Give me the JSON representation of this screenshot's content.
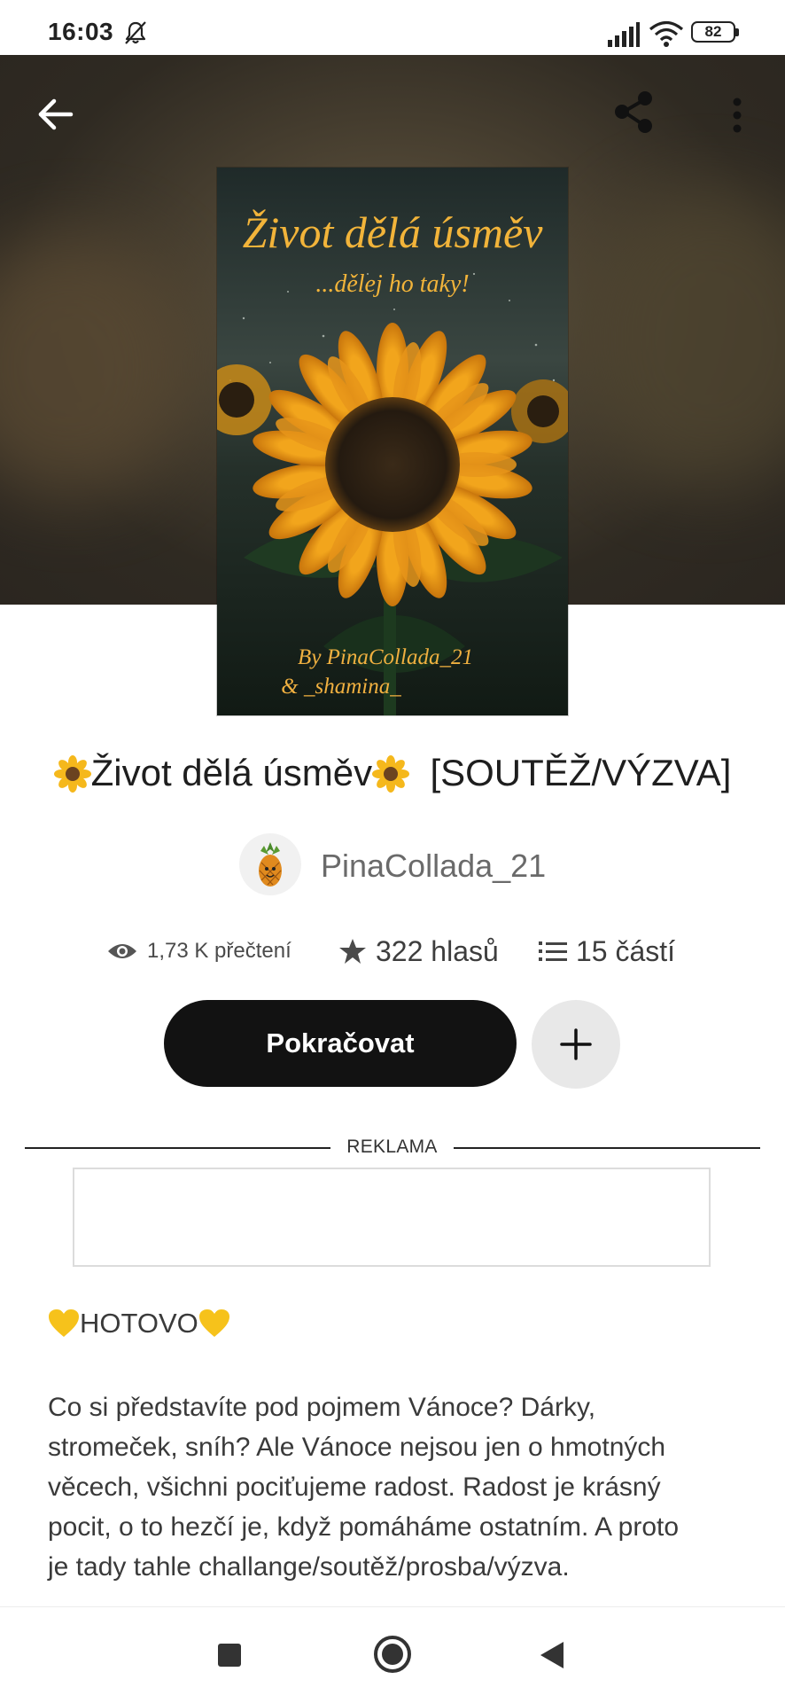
{
  "status_bar": {
    "time": "16:03",
    "battery": "82"
  },
  "header": {
    "back_icon": "arrow-left-icon",
    "share_icon": "share-icon",
    "more_icon": "more-vertical-icon"
  },
  "cover": {
    "title_line": "Život dělá úsměv",
    "subtitle_line": "...dělej ho taky!",
    "byline_1": "By PinaCollada_21",
    "byline_2": "& _shamina_"
  },
  "story": {
    "title_text": "Život dělá úsměv",
    "title_suffix": "[SOUTĚŽ/VÝZVA]",
    "author": "PinaCollada_21",
    "stats": {
      "reads": "1,73 K přečtení",
      "votes": "322 hlasů",
      "parts": "15 částí"
    },
    "continue_label": "Pokračovat",
    "add_icon": "plus-icon"
  },
  "ad": {
    "label": "REKLAMA"
  },
  "description": {
    "status": "HOTOVO",
    "lines": [
      "Co si představíte pod pojmem Vánoce? Dárky,",
      "stromeček, sníh? Ale Vánoce nejsou jen o hmotných",
      "věcech, všichni pociťujeme radost. Radost je krásný",
      "pocit, o to hezčí je, když pomáháme ostatním. A proto",
      "je tady tahle challange/soutěž/prosba/výzva."
    ]
  },
  "colors": {
    "button_dark": "#121212",
    "cover_text": "#f2b43a",
    "header_bg": "#3a3228"
  }
}
